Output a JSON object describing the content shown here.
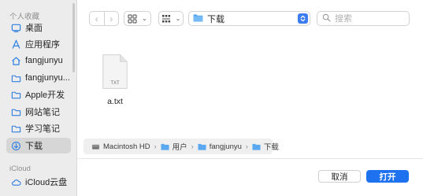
{
  "sidebar": {
    "sections": [
      "个人收藏",
      "iCloud"
    ],
    "items": [
      {
        "label": "桌面",
        "icon": "desktop-icon"
      },
      {
        "label": "应用程序",
        "icon": "applications-icon"
      },
      {
        "label": "fangjunyu",
        "icon": "home-icon"
      },
      {
        "label": "fangjunyu...",
        "icon": "folder-icon"
      },
      {
        "label": "Apple开发",
        "icon": "folder-icon"
      },
      {
        "label": "网站笔记",
        "icon": "folder-icon"
      },
      {
        "label": "学习笔记",
        "icon": "folder-icon"
      },
      {
        "label": "下载",
        "icon": "downloads-icon",
        "selected": true
      },
      {
        "label": "iCloud云盘",
        "icon": "icloud-icon"
      }
    ]
  },
  "toolbar": {
    "location": "下载",
    "search_placeholder": "搜索"
  },
  "files": [
    {
      "name": "a.txt",
      "icon_label": "TXT"
    }
  ],
  "pathbar": [
    "Macintosh HD",
    "用户",
    "fangjunyu",
    "下载"
  ],
  "buttons": {
    "cancel": "取消",
    "open": "打开"
  },
  "colors": {
    "accent": "#1e72ef",
    "folder": "#5aa9f0",
    "sidebar_bg": "#ececec"
  }
}
